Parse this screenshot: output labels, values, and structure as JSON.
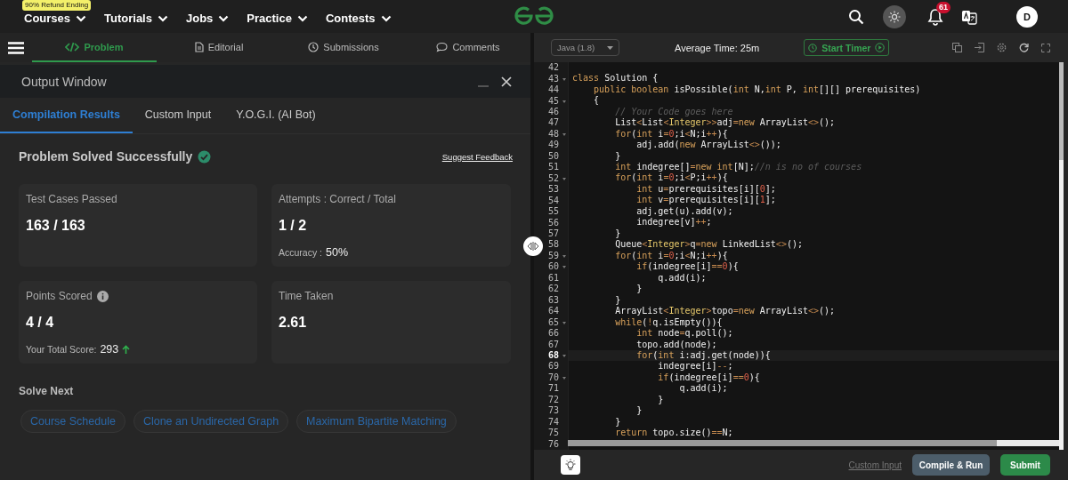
{
  "nav": {
    "promo_badge": "90% Refund Ending",
    "menus": [
      {
        "label": "Courses"
      },
      {
        "label": "Tutorials"
      },
      {
        "label": "Jobs"
      },
      {
        "label": "Practice"
      },
      {
        "label": "Contests"
      }
    ],
    "notification_count": "61",
    "avatar_letter": "D"
  },
  "problem_tabs": [
    {
      "label": "Problem",
      "selected": true
    },
    {
      "label": "Editorial",
      "selected": false
    },
    {
      "label": "Submissions",
      "selected": false
    },
    {
      "label": "Comments",
      "selected": false
    }
  ],
  "output_window": {
    "title": "Output Window",
    "tabs": [
      {
        "label": "Compilation Results",
        "selected": true
      },
      {
        "label": "Custom Input",
        "selected": false
      },
      {
        "label": "Y.O.G.I. (AI Bot)",
        "selected": false
      }
    ],
    "status": "Problem Solved Successfully",
    "feedback_link": "Suggest Feedback",
    "cards": [
      {
        "label": "Test Cases Passed",
        "value": "163 / 163",
        "info": false,
        "trend_up": false
      },
      {
        "label": "Attempts : Correct / Total",
        "value": "1 / 2",
        "info": false,
        "trend_up": false,
        "note_label": "Accuracy :",
        "note_value": "50%"
      },
      {
        "label": "Points Scored",
        "value": "4 / 4",
        "info": true,
        "trend_up": true,
        "note_label": "Your Total Score:",
        "note_value": "293"
      },
      {
        "label": "Time Taken",
        "value": "2.61",
        "info": false,
        "trend_up": false
      }
    ],
    "solve_next": {
      "heading": "Solve Next",
      "problems": [
        "Course Schedule",
        "Clone an Undirected Graph",
        "Maximum Bipartite Matching"
      ]
    }
  },
  "editor": {
    "language": "Java (1.8)",
    "average_time": "Average Time: 25m",
    "timer_button": "Start Timer",
    "lines": [
      {
        "number": "42",
        "foldable": false,
        "active": false
      },
      {
        "number": "43",
        "foldable": true,
        "active": false,
        "tokens": [
          {
            "kind": "kw",
            "text": "class"
          },
          {
            "kind": "txt",
            "text": " Solution {"
          }
        ]
      },
      {
        "number": "44",
        "foldable": false,
        "active": false,
        "tokens": [
          {
            "kind": "kw",
            "text": "    public"
          },
          {
            "kind": "kw",
            "text": " boolean"
          },
          {
            "kind": "txt",
            "text": " isPossible("
          },
          {
            "kind": "kw",
            "text": "int"
          },
          {
            "kind": "txt",
            "text": " N,"
          },
          {
            "kind": "kw",
            "text": "int"
          },
          {
            "kind": "txt",
            "text": " P, "
          },
          {
            "kind": "kw",
            "text": "int"
          },
          {
            "kind": "txt",
            "text": "[][] prerequisites)"
          }
        ]
      },
      {
        "number": "45",
        "foldable": true,
        "active": false,
        "tokens": [
          {
            "kind": "txt",
            "text": "    {"
          }
        ]
      },
      {
        "number": "46",
        "foldable": false,
        "active": false,
        "tokens": [
          {
            "kind": "cmt",
            "text": "        // Your Code goes here"
          }
        ]
      },
      {
        "number": "47",
        "foldable": false,
        "active": false,
        "tokens": [
          {
            "kind": "txt",
            "text": "        List"
          },
          {
            "kind": "op",
            "text": "<"
          },
          {
            "kind": "txt",
            "text": "List"
          },
          {
            "kind": "op",
            "text": "<"
          },
          {
            "kind": "ty",
            "text": "Integer"
          },
          {
            "kind": "op",
            "text": ">>"
          },
          {
            "kind": "txt",
            "text": "adj"
          },
          {
            "kind": "op",
            "text": "="
          },
          {
            "kind": "kw",
            "text": "new"
          },
          {
            "kind": "txt",
            "text": " ArrayList"
          },
          {
            "kind": "op",
            "text": "<>"
          },
          {
            "kind": "txt",
            "text": "();"
          }
        ]
      },
      {
        "number": "48",
        "foldable": true,
        "active": false,
        "tokens": [
          {
            "kind": "kw",
            "text": "        for"
          },
          {
            "kind": "txt",
            "text": "("
          },
          {
            "kind": "kw",
            "text": "int"
          },
          {
            "kind": "txt",
            "text": " i"
          },
          {
            "kind": "op",
            "text": "="
          },
          {
            "kind": "num",
            "text": "0"
          },
          {
            "kind": "txt",
            "text": ";i"
          },
          {
            "kind": "op",
            "text": "<"
          },
          {
            "kind": "txt",
            "text": "N;i"
          },
          {
            "kind": "op",
            "text": "++"
          },
          {
            "kind": "txt",
            "text": "){"
          }
        ]
      },
      {
        "number": "49",
        "foldable": false,
        "active": false,
        "tokens": [
          {
            "kind": "txt",
            "text": "            adj.add("
          },
          {
            "kind": "kw",
            "text": "new"
          },
          {
            "kind": "txt",
            "text": " ArrayList"
          },
          {
            "kind": "op",
            "text": "<>"
          },
          {
            "kind": "txt",
            "text": "());"
          }
        ]
      },
      {
        "number": "50",
        "foldable": false,
        "active": false,
        "tokens": [
          {
            "kind": "txt",
            "text": "        }"
          }
        ]
      },
      {
        "number": "51",
        "foldable": false,
        "active": false,
        "tokens": [
          {
            "kind": "kw",
            "text": "        int"
          },
          {
            "kind": "txt",
            "text": " indegree[]"
          },
          {
            "kind": "op",
            "text": "="
          },
          {
            "kind": "kw",
            "text": "new"
          },
          {
            "kind": "kw",
            "text": " int"
          },
          {
            "kind": "txt",
            "text": "[N];"
          },
          {
            "kind": "cmt",
            "text": "//n is no of courses"
          }
        ]
      },
      {
        "number": "52",
        "foldable": true,
        "active": false,
        "tokens": [
          {
            "kind": "kw",
            "text": "        for"
          },
          {
            "kind": "txt",
            "text": "("
          },
          {
            "kind": "kw",
            "text": "int"
          },
          {
            "kind": "txt",
            "text": " i"
          },
          {
            "kind": "op",
            "text": "="
          },
          {
            "kind": "num",
            "text": "0"
          },
          {
            "kind": "txt",
            "text": ";i"
          },
          {
            "kind": "op",
            "text": "<"
          },
          {
            "kind": "txt",
            "text": "P;i"
          },
          {
            "kind": "op",
            "text": "++"
          },
          {
            "kind": "txt",
            "text": "){"
          }
        ]
      },
      {
        "number": "53",
        "foldable": false,
        "active": false,
        "tokens": [
          {
            "kind": "kw",
            "text": "            int"
          },
          {
            "kind": "txt",
            "text": " u"
          },
          {
            "kind": "op",
            "text": "="
          },
          {
            "kind": "txt",
            "text": "prerequisites[i]["
          },
          {
            "kind": "num",
            "text": "0"
          },
          {
            "kind": "txt",
            "text": "];"
          }
        ]
      },
      {
        "number": "54",
        "foldable": false,
        "active": false,
        "tokens": [
          {
            "kind": "kw",
            "text": "            int"
          },
          {
            "kind": "txt",
            "text": " v"
          },
          {
            "kind": "op",
            "text": "="
          },
          {
            "kind": "txt",
            "text": "prerequisites[i]["
          },
          {
            "kind": "num",
            "text": "1"
          },
          {
            "kind": "txt",
            "text": "];"
          }
        ]
      },
      {
        "number": "55",
        "foldable": false,
        "active": false,
        "tokens": [
          {
            "kind": "txt",
            "text": "            adj.get(u).add(v);"
          }
        ]
      },
      {
        "number": "56",
        "foldable": false,
        "active": false,
        "tokens": [
          {
            "kind": "txt",
            "text": "            indegree[v]"
          },
          {
            "kind": "op",
            "text": "++"
          },
          {
            "kind": "txt",
            "text": ";"
          }
        ]
      },
      {
        "number": "57",
        "foldable": false,
        "active": false,
        "tokens": [
          {
            "kind": "txt",
            "text": "        }"
          }
        ]
      },
      {
        "number": "58",
        "foldable": false,
        "active": false,
        "tokens": [
          {
            "kind": "txt",
            "text": "        Queue"
          },
          {
            "kind": "op",
            "text": "<"
          },
          {
            "kind": "ty",
            "text": "Integer"
          },
          {
            "kind": "op",
            "text": ">"
          },
          {
            "kind": "txt",
            "text": "q"
          },
          {
            "kind": "op",
            "text": "="
          },
          {
            "kind": "kw",
            "text": "new"
          },
          {
            "kind": "txt",
            "text": " LinkedList"
          },
          {
            "kind": "op",
            "text": "<>"
          },
          {
            "kind": "txt",
            "text": "();"
          }
        ]
      },
      {
        "number": "59",
        "foldable": true,
        "active": false,
        "tokens": [
          {
            "kind": "kw",
            "text": "        for"
          },
          {
            "kind": "txt",
            "text": "("
          },
          {
            "kind": "kw",
            "text": "int"
          },
          {
            "kind": "txt",
            "text": " i"
          },
          {
            "kind": "op",
            "text": "="
          },
          {
            "kind": "num",
            "text": "0"
          },
          {
            "kind": "txt",
            "text": ";i"
          },
          {
            "kind": "op",
            "text": "<"
          },
          {
            "kind": "txt",
            "text": "N;i"
          },
          {
            "kind": "op",
            "text": "++"
          },
          {
            "kind": "txt",
            "text": "){"
          }
        ]
      },
      {
        "number": "60",
        "foldable": true,
        "active": false,
        "tokens": [
          {
            "kind": "kw",
            "text": "            if"
          },
          {
            "kind": "txt",
            "text": "(indegree[i]"
          },
          {
            "kind": "op",
            "text": "=="
          },
          {
            "kind": "num",
            "text": "0"
          },
          {
            "kind": "txt",
            "text": "){"
          }
        ]
      },
      {
        "number": "61",
        "foldable": false,
        "active": false,
        "tokens": [
          {
            "kind": "txt",
            "text": "                q.add(i);"
          }
        ]
      },
      {
        "number": "62",
        "foldable": false,
        "active": false,
        "tokens": [
          {
            "kind": "txt",
            "text": "            }"
          }
        ]
      },
      {
        "number": "63",
        "foldable": false,
        "active": false,
        "tokens": [
          {
            "kind": "txt",
            "text": "        }"
          }
        ]
      },
      {
        "number": "64",
        "foldable": false,
        "active": false,
        "tokens": [
          {
            "kind": "txt",
            "text": "        ArrayList"
          },
          {
            "kind": "op",
            "text": "<"
          },
          {
            "kind": "ty",
            "text": "Integer"
          },
          {
            "kind": "op",
            "text": ">"
          },
          {
            "kind": "txt",
            "text": "topo"
          },
          {
            "kind": "op",
            "text": "="
          },
          {
            "kind": "kw",
            "text": "new"
          },
          {
            "kind": "txt",
            "text": " ArrayList"
          },
          {
            "kind": "op",
            "text": "<>"
          },
          {
            "kind": "txt",
            "text": "();"
          }
        ]
      },
      {
        "number": "65",
        "foldable": true,
        "active": false,
        "tokens": [
          {
            "kind": "kw",
            "text": "        while"
          },
          {
            "kind": "txt",
            "text": "("
          },
          {
            "kind": "op",
            "text": "!"
          },
          {
            "kind": "txt",
            "text": "q.isEmpty()){"
          }
        ]
      },
      {
        "number": "66",
        "foldable": false,
        "active": false,
        "tokens": [
          {
            "kind": "kw",
            "text": "            int"
          },
          {
            "kind": "txt",
            "text": " node"
          },
          {
            "kind": "op",
            "text": "="
          },
          {
            "kind": "txt",
            "text": "q.poll();"
          }
        ]
      },
      {
        "number": "67",
        "foldable": false,
        "active": false,
        "tokens": [
          {
            "kind": "txt",
            "text": "            topo.add(node);"
          }
        ]
      },
      {
        "number": "68",
        "foldable": true,
        "active": true,
        "tokens": [
          {
            "kind": "kw",
            "text": "            for"
          },
          {
            "kind": "txt",
            "text": "("
          },
          {
            "kind": "kw",
            "text": "int"
          },
          {
            "kind": "txt",
            "text": " i:adj.get(node)){"
          }
        ]
      },
      {
        "number": "69",
        "foldable": false,
        "active": false,
        "tokens": [
          {
            "kind": "txt",
            "text": "                indegree[i]"
          },
          {
            "kind": "op",
            "text": "--"
          },
          {
            "kind": "txt",
            "text": ";"
          }
        ]
      },
      {
        "number": "70",
        "foldable": true,
        "active": false,
        "tokens": [
          {
            "kind": "kw",
            "text": "                if"
          },
          {
            "kind": "txt",
            "text": "(indegree[i]"
          },
          {
            "kind": "op",
            "text": "=="
          },
          {
            "kind": "num",
            "text": "0"
          },
          {
            "kind": "txt",
            "text": "){"
          }
        ]
      },
      {
        "number": "71",
        "foldable": false,
        "active": false,
        "tokens": [
          {
            "kind": "txt",
            "text": "                    q.add(i);"
          }
        ]
      },
      {
        "number": "72",
        "foldable": false,
        "active": false,
        "tokens": [
          {
            "kind": "txt",
            "text": "                }"
          }
        ]
      },
      {
        "number": "73",
        "foldable": false,
        "active": false,
        "tokens": [
          {
            "kind": "txt",
            "text": "            }"
          }
        ]
      },
      {
        "number": "74",
        "foldable": false,
        "active": false,
        "tokens": [
          {
            "kind": "txt",
            "text": "        }"
          }
        ]
      },
      {
        "number": "75",
        "foldable": false,
        "active": false,
        "tokens": [
          {
            "kind": "kw",
            "text": "        return"
          },
          {
            "kind": "txt",
            "text": " topo.size()"
          },
          {
            "kind": "op",
            "text": "=="
          },
          {
            "kind": "txt",
            "text": "N;"
          }
        ]
      },
      {
        "number": "76",
        "foldable": false,
        "active": false
      }
    ],
    "footer": {
      "custom_input": "Custom Input",
      "compile_button": "Compile & Run",
      "submit_button": "Submit"
    }
  }
}
